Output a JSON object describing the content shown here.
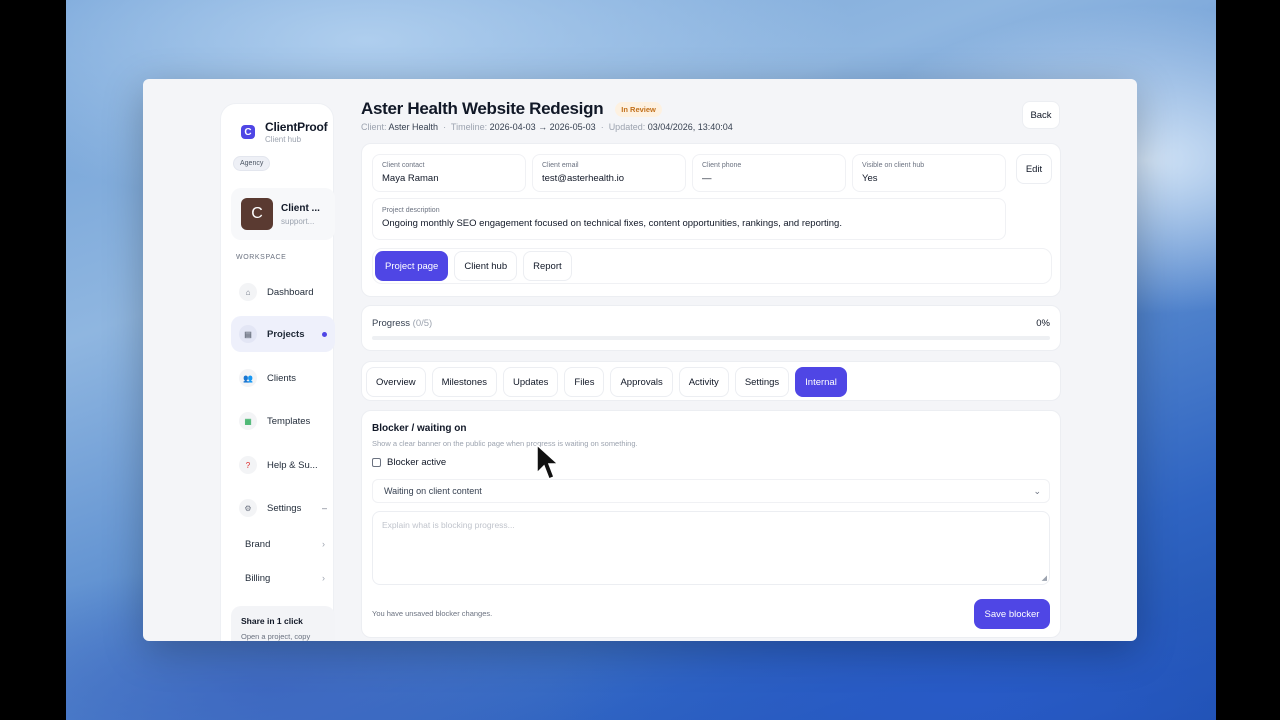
{
  "brand": {
    "name": "ClientProof",
    "subtitle": "Client hub",
    "role": "Agency",
    "logo_letter": "C"
  },
  "client": {
    "avatar_letter": "C",
    "name": "Client ...",
    "sub": "support..."
  },
  "sidebar": {
    "section_label": "WORKSPACE",
    "items": [
      {
        "label": "Dashboard",
        "icon": "home-icon"
      },
      {
        "label": "Projects",
        "icon": "folder-icon",
        "active": true
      },
      {
        "label": "Clients",
        "icon": "users-icon"
      },
      {
        "label": "Templates",
        "icon": "templates-icon"
      },
      {
        "label": "Help & Su...",
        "icon": "help-icon"
      },
      {
        "label": "Settings",
        "icon": "gear-icon",
        "trailing": "–"
      }
    ],
    "sub_items": [
      {
        "label": "Brand"
      },
      {
        "label": "Billing"
      }
    ],
    "share": {
      "title": "Share in 1 click",
      "text": "Open a project, copy"
    }
  },
  "project": {
    "title": "Aster Health Website Redesign",
    "status": "In Review",
    "meta": {
      "client_label": "Client:",
      "client": "Aster Health",
      "timeline_label": "Timeline:",
      "timeline": "2026-04-03 → 2026-05-03",
      "updated_label": "Updated:",
      "updated": "03/04/2026, 13:40:04"
    },
    "back_label": "Back",
    "edit_label": "Edit",
    "contact": {
      "label": "Client contact",
      "value": "Maya Raman"
    },
    "email": {
      "label": "Client email",
      "value": "test@asterhealth.io"
    },
    "phone": {
      "label": "Client phone",
      "value": "—"
    },
    "visible": {
      "label": "Visible on client hub",
      "value": "Yes"
    },
    "description": {
      "label": "Project description",
      "value": "Ongoing monthly SEO engagement focused on technical fixes, content opportunities, rankings, and reporting."
    },
    "views": [
      "Project page",
      "Client hub",
      "Report"
    ]
  },
  "progress": {
    "label": "Progress",
    "count": "(0/5)",
    "percent_text": "0%",
    "fraction": 0
  },
  "tabs": [
    "Overview",
    "Milestones",
    "Updates",
    "Files",
    "Approvals",
    "Activity",
    "Settings",
    "Internal"
  ],
  "blocker": {
    "title": "Blocker / waiting on",
    "description": "Show a clear banner on the public page when progress is waiting on something.",
    "checkbox_label": "Blocker active",
    "select_value": "Waiting on client content",
    "textarea_placeholder": "Explain what is blocking progress...",
    "unsaved_text": "You have unsaved blocker changes.",
    "save_label": "Save blocker"
  },
  "colors": {
    "accent": "#4f46e5",
    "status_bg": "#fdf1e1",
    "status_text": "#c2701a"
  }
}
